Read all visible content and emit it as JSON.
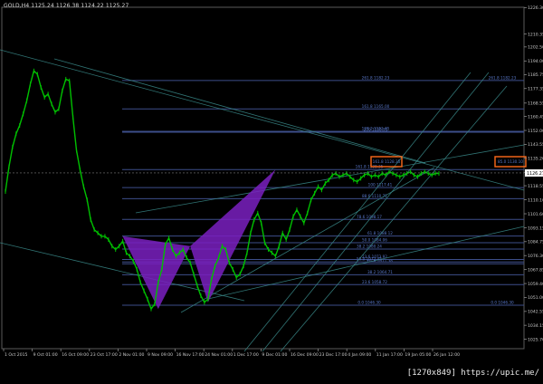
{
  "header": {
    "symbol": "GOLD,H4",
    "ohlc": "1125.24 1126.38 1124.22 1125.27"
  },
  "watermark": "[1270x849] https://upic.me/",
  "colors": {
    "background": "#000000",
    "price_line": "#00c000",
    "fib_line": "#3d4e8a",
    "channel_line": "#3a8a8a",
    "pattern_fill": "#7a20c0",
    "highlight_box": "#ff6a1a",
    "axis_text": "#c8c8c8",
    "fib_text": "#5877c8"
  },
  "chart_data": {
    "type": "line",
    "title": "GOLD,H4",
    "ylim": [
      1020.0,
      1226.5
    ],
    "y_ticks": [
      "1226.30",
      "1210.35",
      "1202.50",
      "1194.00",
      "1185.75",
      "1177.35",
      "1168.55",
      "1160.45",
      "1152.00",
      "1143.55",
      "1135.20",
      "1126.60",
      "1118.55",
      "1110.10",
      "1101.60",
      "1093.15",
      "1084.75",
      "1076.30",
      "1067.85",
      "1059.40",
      "1051.00",
      "1042.55",
      "1034.15",
      "1025.70"
    ],
    "x_ticks": [
      "1 Oct 2015",
      "9 Oct 01:00",
      "16 Oct 09:00",
      "23 Oct 17:00",
      "2 Nov 01:00",
      "9 Nov 09:00",
      "16 Nov 17:00",
      "24 Nov 01:00",
      "1 Dec 17:00",
      "9 Dec 01:00",
      "16 Dec 09:00",
      "23 Dec 17:00",
      "4 Jan 09:00",
      "11 Jan 17:00",
      "19 Jan 05:00",
      "26 Jan 12:00"
    ],
    "current_price": "1126.27",
    "series": [
      {
        "x": [
          0,
          2,
          4,
          6,
          8,
          10,
          12,
          14,
          16,
          18,
          20,
          22,
          24,
          26,
          28,
          30,
          32,
          34,
          36,
          38,
          40,
          42,
          44,
          46,
          48,
          50,
          52,
          54,
          56,
          58,
          60,
          62,
          64,
          66,
          68,
          70,
          72,
          74,
          76,
          78,
          80,
          82,
          84,
          86,
          88,
          90,
          92,
          94,
          96,
          98,
          100,
          102,
          104,
          106,
          108,
          110,
          112,
          114,
          116,
          118,
          120,
          122,
          124,
          126,
          128,
          130,
          132,
          134,
          136,
          138,
          140,
          142,
          144,
          146,
          148,
          150,
          152,
          154,
          156,
          158,
          160,
          162,
          164,
          166,
          168,
          170,
          172,
          174,
          176,
          178,
          180,
          182,
          184,
          186,
          188,
          190,
          192,
          194,
          196,
          198,
          200,
          202,
          204,
          206,
          208,
          210,
          212,
          214,
          216,
          218,
          220,
          222,
          224,
          226,
          228,
          230,
          232,
          234,
          236,
          238,
          240,
          242,
          244
        ],
        "values": [
          1115,
          1130,
          1142,
          1150,
          1155,
          1162,
          1170,
          1180,
          1188,
          1186,
          1178,
          1172,
          1174,
          1168,
          1163,
          1165,
          1176,
          1183,
          1182,
          1160,
          1140,
          1128,
          1118,
          1110,
          1098,
          1092,
          1090,
          1088,
          1088,
          1086,
          1082,
          1080,
          1082,
          1085,
          1078,
          1076,
          1073,
          1068,
          1060,
          1055,
          1050,
          1044,
          1047,
          1060,
          1068,
          1083,
          1087,
          1080,
          1076,
          1078,
          1080,
          1075,
          1072,
          1065,
          1058,
          1052,
          1048,
          1050,
          1062,
          1070,
          1075,
          1082,
          1080,
          1072,
          1068,
          1063,
          1065,
          1070,
          1078,
          1090,
          1098,
          1102,
          1096,
          1084,
          1080,
          1078,
          1076,
          1082,
          1090,
          1086,
          1092,
          1100,
          1104,
          1100,
          1096,
          1102,
          1110,
          1114,
          1118,
          1116,
          1120,
          1122,
          1125,
          1126,
          1124,
          1125,
          1126,
          1124,
          1122,
          1121,
          1123,
          1125,
          1126,
          1124,
          1125,
          1124,
          1126,
          1125,
          1127,
          1126,
          1125,
          1124,
          1125,
          1126,
          1127,
          1125,
          1124,
          1126,
          1127,
          1126,
          1125,
          1126,
          1126
        ]
      }
    ],
    "fib_labels": [
      {
        "text": "261.8 1182.23",
        "value": 1182.23
      },
      {
        "text": "261.8 1182.23",
        "value": 1182.23,
        "side": "right"
      },
      {
        "text": "161.8 1165.00",
        "value": 1165.0
      },
      {
        "text": "200 1150.93",
        "value": 1150.93
      },
      {
        "text": "127.2 1151.45",
        "value": 1151.45
      },
      {
        "text": "161.8 1128.35",
        "value": 1128.35
      },
      {
        "text": "100 1117.41",
        "value": 1117.41
      },
      {
        "text": "88.6 1110.71",
        "value": 1110.71
      },
      {
        "text": "78.6 1098.17",
        "value": 1098.17
      },
      {
        "text": "61.8 1088.12",
        "value": 1088.12
      },
      {
        "text": "50.0 1084.06",
        "value": 1084.06
      },
      {
        "text": "38.2 1080.24",
        "value": 1080.24
      },
      {
        "text": "61.8 1071.38",
        "value": 1071.38
      },
      {
        "text": "23.6 1073.92",
        "value": 1073.92
      },
      {
        "text": "50.0 1072.45",
        "value": 1072.45
      },
      {
        "text": "38.2 1064.71",
        "value": 1064.71
      },
      {
        "text": "23.6 1058.72",
        "value": 1058.72
      },
      {
        "text": "0.0 1046.30",
        "value": 1046.3
      },
      {
        "text": "0.0 1046.30",
        "value": 1046.3,
        "side": "right"
      }
    ],
    "boxed_labels": [
      "161.8 1128.35",
      "85.0 1130.10"
    ]
  }
}
